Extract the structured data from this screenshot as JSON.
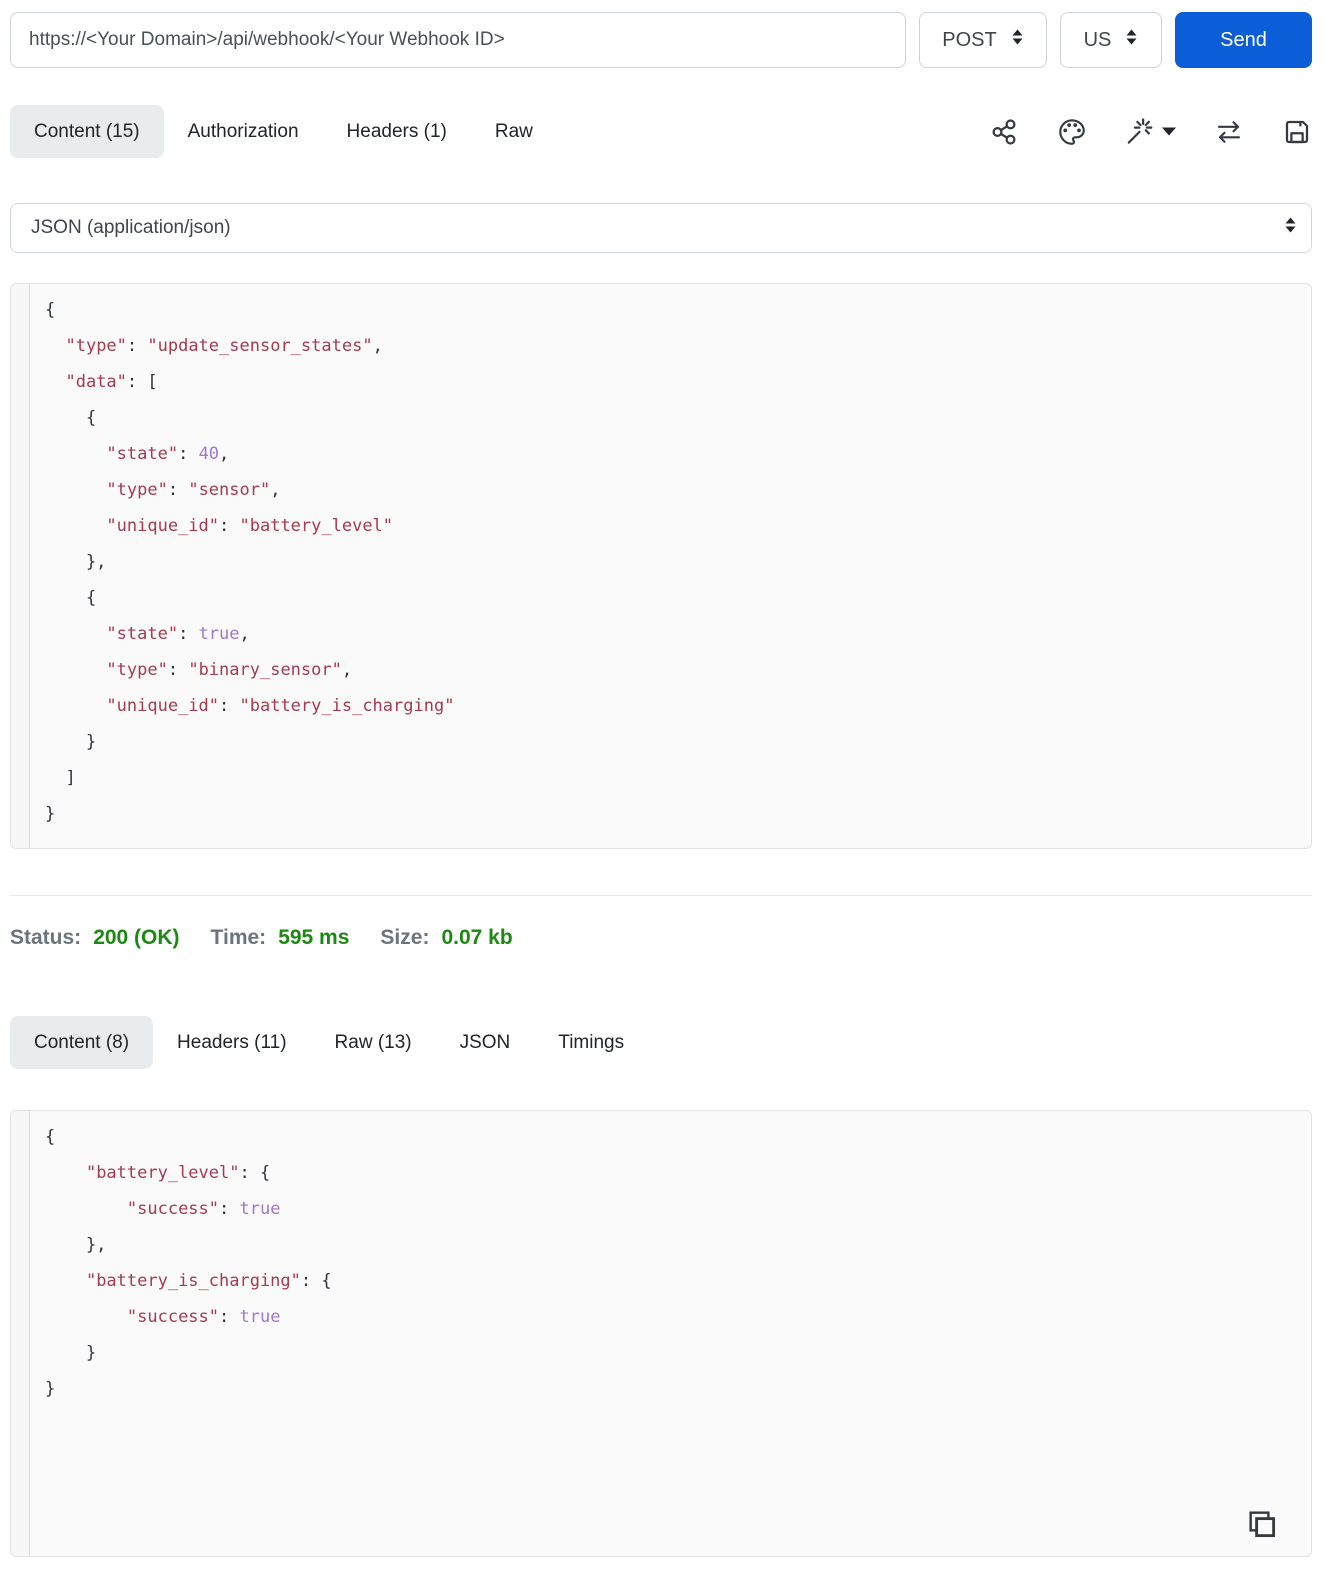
{
  "colors": {
    "accent_blue": "#0b5ed7",
    "status_green": "#1d8912",
    "code_string_red": "#a63a50",
    "code_literal_purple": "#a078ce",
    "active_tab_bg": "#e9ecef"
  },
  "request_bar": {
    "url_value": "https://<Your Domain>/api/webhook/<Your Webhook ID>",
    "method_value": "POST",
    "region_value": "US",
    "send_label": "Send"
  },
  "request_tabs": {
    "content": "Content (15)",
    "authorization": "Authorization",
    "headers": "Headers (1)",
    "raw": "Raw"
  },
  "toolbar": {
    "icons": [
      "share-icon",
      "palette-icon",
      "magic-wand-icon",
      "swap-arrows-icon",
      "save-icon"
    ]
  },
  "body_type_select": {
    "value": "JSON (application/json)"
  },
  "request_body": {
    "lines": [
      [
        [
          "p",
          "{"
        ]
      ],
      [
        [
          "p",
          "  "
        ],
        [
          "s",
          "\"type\""
        ],
        [
          "p",
          ": "
        ],
        [
          "s",
          "\"update_sensor_states\""
        ],
        [
          "p",
          ","
        ]
      ],
      [
        [
          "p",
          "  "
        ],
        [
          "s",
          "\"data\""
        ],
        [
          "p",
          ": ["
        ]
      ],
      [
        [
          "p",
          "    {"
        ]
      ],
      [
        [
          "p",
          "      "
        ],
        [
          "s",
          "\"state\""
        ],
        [
          "p",
          ": "
        ],
        [
          "l",
          "40"
        ],
        [
          "p",
          ","
        ]
      ],
      [
        [
          "p",
          "      "
        ],
        [
          "s",
          "\"type\""
        ],
        [
          "p",
          ": "
        ],
        [
          "s",
          "\"sensor\""
        ],
        [
          "p",
          ","
        ]
      ],
      [
        [
          "p",
          "      "
        ],
        [
          "s",
          "\"unique_id\""
        ],
        [
          "p",
          ": "
        ],
        [
          "s",
          "\"battery_level\""
        ]
      ],
      [
        [
          "p",
          "    },"
        ]
      ],
      [
        [
          "p",
          "    {"
        ]
      ],
      [
        [
          "p",
          "      "
        ],
        [
          "s",
          "\"state\""
        ],
        [
          "p",
          ": "
        ],
        [
          "l",
          "true"
        ],
        [
          "p",
          ","
        ]
      ],
      [
        [
          "p",
          "      "
        ],
        [
          "s",
          "\"type\""
        ],
        [
          "p",
          ": "
        ],
        [
          "s",
          "\"binary_sensor\""
        ],
        [
          "p",
          ","
        ]
      ],
      [
        [
          "p",
          "      "
        ],
        [
          "s",
          "\"unique_id\""
        ],
        [
          "p",
          ": "
        ],
        [
          "s",
          "\"battery_is_charging\""
        ]
      ],
      [
        [
          "p",
          "    }"
        ]
      ],
      [
        [
          "p",
          "  ]"
        ]
      ],
      [
        [
          "p",
          "}"
        ]
      ]
    ]
  },
  "status_bar": {
    "status_label": "Status:",
    "status_value": "200 (OK)",
    "time_label": "Time:",
    "time_value": "595 ms",
    "size_label": "Size:",
    "size_value": "0.07 kb"
  },
  "response_tabs": {
    "content": "Content (8)",
    "headers": "Headers (11)",
    "raw": "Raw (13)",
    "json": "JSON",
    "timings": "Timings"
  },
  "response_body": {
    "lines": [
      [
        [
          "p",
          "{"
        ]
      ],
      [
        [
          "p",
          "    "
        ],
        [
          "s",
          "\"battery_level\""
        ],
        [
          "p",
          ": {"
        ]
      ],
      [
        [
          "p",
          "        "
        ],
        [
          "s",
          "\"success\""
        ],
        [
          "p",
          ": "
        ],
        [
          "l",
          "true"
        ]
      ],
      [
        [
          "p",
          "    },"
        ]
      ],
      [
        [
          "p",
          "    "
        ],
        [
          "s",
          "\"battery_is_charging\""
        ],
        [
          "p",
          ": {"
        ]
      ],
      [
        [
          "p",
          "        "
        ],
        [
          "s",
          "\"success\""
        ],
        [
          "p",
          ": "
        ],
        [
          "l",
          "true"
        ]
      ],
      [
        [
          "p",
          "    }"
        ]
      ],
      [
        [
          "p",
          "}"
        ]
      ]
    ]
  }
}
